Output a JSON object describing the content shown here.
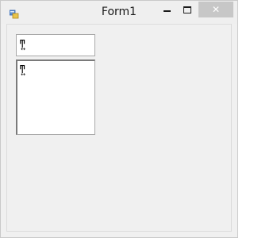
{
  "window": {
    "title": "Form1",
    "controls": {
      "minimize_icon": "minimize-icon",
      "maximize_icon": "maximize-icon",
      "close_glyph": "✕"
    },
    "app_icon": "form-app-icon",
    "accent": {
      "close_button_bg": "#c7c7c7",
      "client_bg": "#f0f0f0"
    }
  },
  "form": {
    "textbox": {
      "value": "ͳ͍"
    },
    "multiline_textbox": {
      "value": "ͳ͍"
    }
  }
}
